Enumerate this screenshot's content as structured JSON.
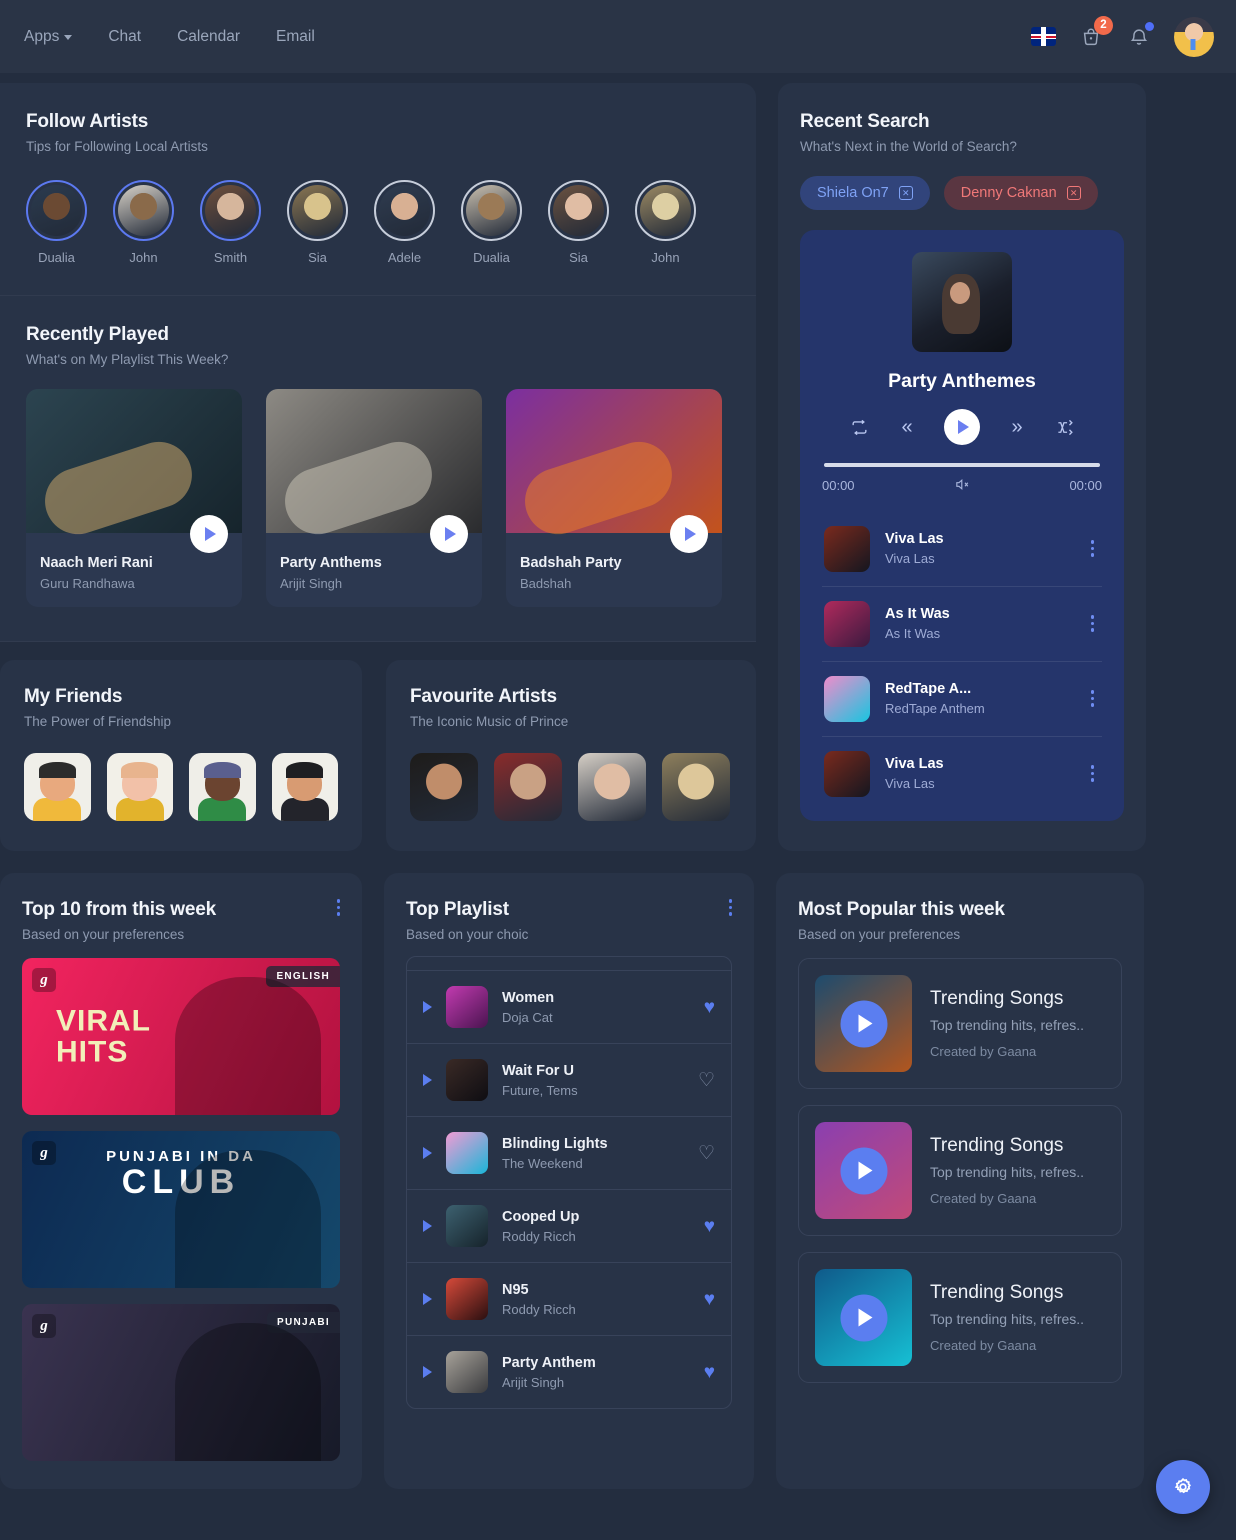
{
  "topbar": {
    "nav": [
      {
        "label": "Apps",
        "has_caret": true
      },
      {
        "label": "Chat",
        "has_caret": false
      },
      {
        "label": "Calendar",
        "has_caret": false
      },
      {
        "label": "Email",
        "has_caret": false
      }
    ],
    "flag_icon": "uk-flag-icon",
    "cart_icon": "shopping-basket-icon",
    "cart_badge": "2",
    "bell_icon": "notification-bell-icon",
    "avatar_icon": "user-avatar"
  },
  "follow_artists": {
    "title": "Follow Artists",
    "subtitle": "Tips for Following Local Artists",
    "items": [
      {
        "name": "Dualia",
        "followed": true,
        "c1": "#6b4a33",
        "c2": "#2b3b4f"
      },
      {
        "name": "John",
        "followed": true,
        "c1": "#8a6a4a",
        "c2": "#d8d2c8"
      },
      {
        "name": "Smith",
        "followed": true,
        "c1": "#d6b69c",
        "c2": "#6e4f3c"
      },
      {
        "name": "Sia",
        "followed": false,
        "c1": "#d8c38c",
        "c2": "#8a7652"
      },
      {
        "name": "Adele",
        "followed": false,
        "c1": "#d8b093",
        "c2": "#2f3c50"
      },
      {
        "name": "Dualia",
        "followed": false,
        "c1": "#9b7a56",
        "c2": "#c9bfae"
      },
      {
        "name": "Sia",
        "followed": false,
        "c1": "#e0bda4",
        "c2": "#6b5240"
      },
      {
        "name": "John",
        "followed": false,
        "c1": "#ddcfa3",
        "c2": "#9c8a63"
      }
    ]
  },
  "recently_played": {
    "title": "Recently Played",
    "subtitle": "What's on My Playlist This Week?",
    "cards": [
      {
        "title": "Naach Meri Rani",
        "artist": "Guru Randhawa",
        "c1": "#2c4450",
        "c2": "#16242c",
        "accent": "#c8a46a"
      },
      {
        "title": "Party Anthems",
        "artist": "Arijit Singh",
        "c1": "#8d8a84",
        "c2": "#2a2b2e",
        "accent": "#c9c2b4"
      },
      {
        "title": "Badshah Party",
        "artist": "Badshah",
        "c1": "#7b2fa0",
        "c2": "#c3531c",
        "accent": "#e87b2a"
      }
    ],
    "play_icon": "play-icon"
  },
  "my_friends": {
    "title": "My Friends",
    "subtitle": "The Power of Friendship",
    "avatars": [
      {
        "name": "friend-avatar-1",
        "bg": "#f0efe9",
        "skin": "#e8a97e",
        "hair": "#2c2c2c",
        "shirt": "#f0b93b"
      },
      {
        "name": "friend-avatar-2",
        "bg": "#f2f0e8",
        "skin": "#f2c1a8",
        "hair": "#e8b48e",
        "shirt": "#e2b32c"
      },
      {
        "name": "friend-avatar-3",
        "bg": "#efeee8",
        "skin": "#6b4430",
        "hair": "#5a5f8e",
        "shirt": "#2f8c46"
      },
      {
        "name": "friend-avatar-4",
        "bg": "#f0efe9",
        "skin": "#d89b72",
        "hair": "#1f1f22",
        "shirt": "#23242b"
      }
    ]
  },
  "favourite_artists": {
    "title": "Favourite Artists",
    "subtitle": "The Iconic Music of Prince",
    "avatars": [
      {
        "name": "fav-artist-1",
        "c1": "#c08d6a",
        "c2": "#1e1c1a"
      },
      {
        "name": "fav-artist-2",
        "c1": "#c9a184",
        "c2": "#8a2b2b"
      },
      {
        "name": "fav-artist-3",
        "c1": "#e0bda4",
        "c2": "#d6cfc6"
      },
      {
        "name": "fav-artist-4",
        "c1": "#ddc79a",
        "c2": "#8e7f5c"
      }
    ]
  },
  "recent_search": {
    "title": "Recent Search",
    "subtitle": "What's Next in the World of Search?",
    "chips": [
      {
        "label": "Shiela On7",
        "style": "blue",
        "close_icon": "close-icon"
      },
      {
        "label": "Denny Caknan",
        "style": "red",
        "close_icon": "close-icon"
      }
    ]
  },
  "player": {
    "album_art": "party-anthemes-cover",
    "title": "Party Anthemes",
    "controls": [
      {
        "name": "repeat-button",
        "glyph": "↻"
      },
      {
        "name": "previous-button",
        "glyph": "«"
      },
      {
        "name": "play-button",
        "glyph": "▶"
      },
      {
        "name": "next-button",
        "glyph": "»"
      },
      {
        "name": "shuffle-button",
        "glyph": "⇄"
      }
    ],
    "time_elapsed": "00:00",
    "time_total": "00:00",
    "volume_icon": "volume-muted-icon",
    "progress_percent": 100,
    "tracks": [
      {
        "title": "Viva Las",
        "artist": "Viva Las",
        "c1": "#7a2a1e",
        "c2": "#14161f"
      },
      {
        "title": "As It Was",
        "artist": "As It Was",
        "c1": "#b02a5c",
        "c2": "#3a1a40"
      },
      {
        "title": "RedTape A...",
        "artist": "RedTape Anthem",
        "c1": "#f08ccb",
        "c2": "#18c5e0"
      },
      {
        "title": "Viva Las",
        "artist": "Viva Las",
        "c1": "#7a2a1e",
        "c2": "#14161f"
      }
    ]
  },
  "top10": {
    "title": "Top 10 from this week",
    "subtitle": "Based on your preferences",
    "menu_icon": "more-options-icon",
    "banners": [
      {
        "name": "viral-hits-banner",
        "text_line1": "VIRAL",
        "text_line2": "HITS",
        "tag": "ENGLISH",
        "logo": "g",
        "c1": "#f2245f",
        "c2": "#b2123f",
        "text_color": "#f2efb9",
        "show_tag": true
      },
      {
        "name": "punjabi-in-da-club-banner",
        "text_line1": "PUNJABI IN DA",
        "text_line2": "CLUB",
        "tag": "",
        "logo": "g",
        "c1": "#0d2a52",
        "c2": "#15486b",
        "text_color": "#ffffff",
        "show_tag": false
      },
      {
        "name": "punjabi-banner",
        "text_line1": "",
        "text_line2": "",
        "tag": "PUNJABI",
        "logo": "g",
        "c1": "#3a3350",
        "c2": "#171a28",
        "text_color": "#ffffff",
        "show_tag": true
      }
    ]
  },
  "top_playlist": {
    "title": "Top Playlist",
    "subtitle": "Based on your choic",
    "menu_icon": "more-options-icon",
    "play_icon": "play-icon",
    "heart_icon": "heart-icon",
    "tracks": [
      {
        "title": "Women",
        "artist": "Doja Cat",
        "liked": true,
        "c1": "#c23bb0",
        "c2": "#4a1450"
      },
      {
        "title": "Wait For U",
        "artist": "Future, Tems",
        "liked": false,
        "c1": "#3a2a26",
        "c2": "#0e0d12"
      },
      {
        "title": "Blinding Lights",
        "artist": "The Weekend",
        "liked": false,
        "c1": "#f29bd4",
        "c2": "#19b6d8"
      },
      {
        "title": "Cooped Up",
        "artist": "Roddy Ricch",
        "liked": true,
        "c1": "#3d6170",
        "c2": "#16232b"
      },
      {
        "title": "N95",
        "artist": "Roddy Ricch",
        "liked": true,
        "c1": "#d64a3a",
        "c2": "#2a0f10"
      },
      {
        "title": "Party Anthem",
        "artist": "Arijit Singh",
        "liked": true,
        "c1": "#a7a29a",
        "c2": "#3a3b3e"
      }
    ]
  },
  "most_popular": {
    "title": "Most Popular this week",
    "subtitle": "Based on your preferences",
    "play_icon": "play-icon",
    "items": [
      {
        "title": "Trending Songs",
        "desc": "Top trending hits, refres..",
        "creator": "Created by Gaana",
        "c1": "#1d4b6e",
        "c2": "#b2561e"
      },
      {
        "title": "Trending Songs",
        "desc": "Top trending hits, refres..",
        "creator": "Created by Gaana",
        "c1": "#8a3fb0",
        "c2": "#c24a78"
      },
      {
        "title": "Trending Songs",
        "desc": "Top trending hits, refres..",
        "creator": "Created by Gaana",
        "c1": "#0f5a8a",
        "c2": "#16c0d4"
      }
    ]
  },
  "fab": {
    "icon": "gear-icon",
    "color": "#5b7ef0"
  }
}
